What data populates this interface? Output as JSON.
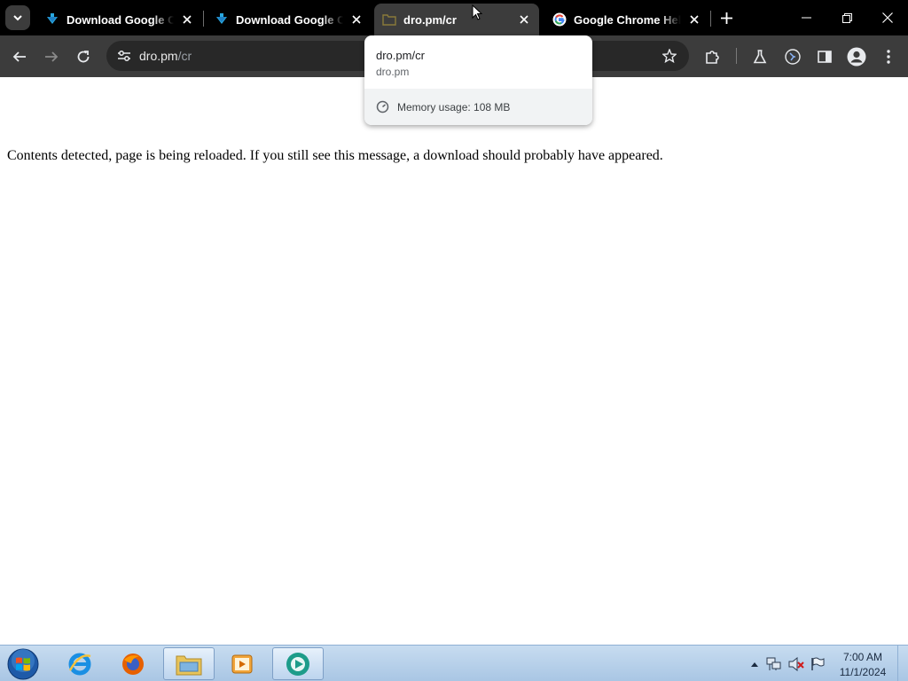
{
  "browser": {
    "tabs": [
      {
        "title": "Download Google Chrome",
        "favicon": "blue-download-arrow-icon",
        "active": false
      },
      {
        "title": "Download Google Chrome",
        "favicon": "blue-download-arrow-icon",
        "active": false
      },
      {
        "title": "dro.pm/cr",
        "favicon": "folder-icon",
        "active": true
      },
      {
        "title": "Google Chrome Help",
        "favicon": "google-g-icon",
        "active": false
      }
    ],
    "toolbar": {
      "url_host": "dro.pm",
      "url_path": "/cr"
    },
    "hover_card": {
      "title": "dro.pm/cr",
      "domain": "dro.pm",
      "memory": "Memory usage: 108 MB"
    },
    "colors": {
      "tabstrip_bg": "#000000",
      "toolbar_bg": "#3c3c3c",
      "active_tab_bg": "#3c3c3c",
      "omnibox_bg": "#282828"
    }
  },
  "page": {
    "message": "Contents detected, page is being reloaded. If you still see this message, a download should probably have appeared."
  },
  "taskbar": {
    "apps": [
      "internet-explorer-icon",
      "firefox-icon",
      "file-explorer-icon",
      "media-player-icon",
      "app-icon"
    ],
    "clock_time": "7:00 AM",
    "clock_date": "11/1/2024"
  }
}
